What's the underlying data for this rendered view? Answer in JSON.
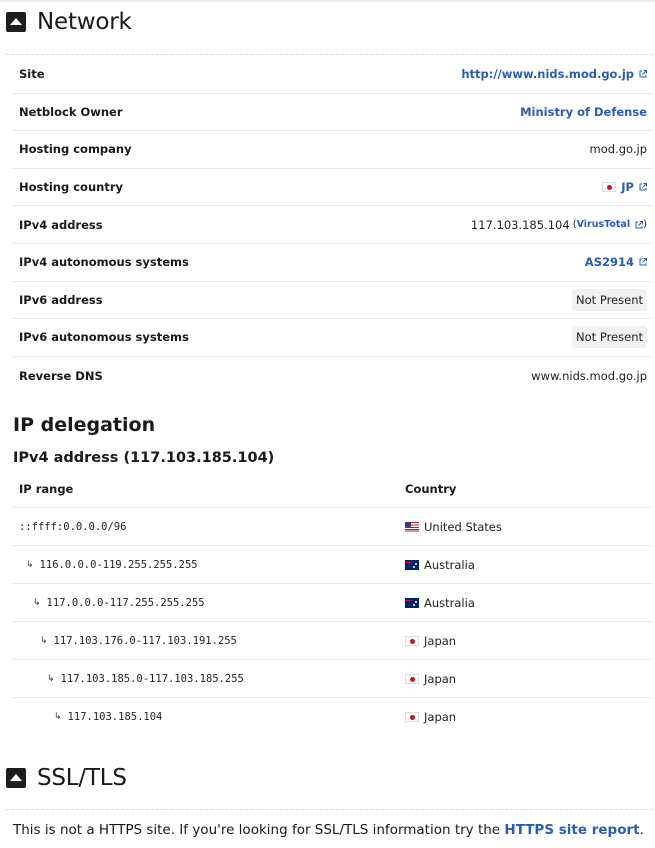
{
  "network": {
    "title": "Network",
    "rows": [
      {
        "label": "Site",
        "value": "http://www.nids.mod.go.jp",
        "kind": "link-ext"
      },
      {
        "label": "Netblock Owner",
        "value": "Ministry of Defense",
        "kind": "link"
      },
      {
        "label": "Hosting company",
        "value": "mod.go.jp",
        "kind": "text"
      },
      {
        "label": "Hosting country",
        "value": "JP",
        "kind": "flag-link",
        "flag": "jp"
      },
      {
        "label": "IPv4 address",
        "value": "117.103.185.104",
        "kind": "ip-vt",
        "extra": "VirusTotal"
      },
      {
        "label": "IPv4 autonomous systems",
        "value": "AS2914",
        "kind": "link-ext"
      },
      {
        "label": "IPv6 address",
        "value": "Not Present",
        "kind": "pill"
      },
      {
        "label": "IPv6 autonomous systems",
        "value": "Not Present",
        "kind": "pill"
      },
      {
        "label": "Reverse DNS",
        "value": "www.nids.mod.go.jp",
        "kind": "text"
      }
    ]
  },
  "ip_delegation": {
    "title": "IP delegation",
    "subtitle": "IPv4 address (117.103.185.104)",
    "headers": {
      "range": "IP range",
      "country": "Country"
    },
    "rows": [
      {
        "range": "::ffff:0.0.0.0/96",
        "country": "United States",
        "flag": "us",
        "indent": 0
      },
      {
        "range": "116.0.0.0-119.255.255.255",
        "country": "Australia",
        "flag": "au",
        "indent": 1
      },
      {
        "range": "117.0.0.0-117.255.255.255",
        "country": "Australia",
        "flag": "au",
        "indent": 2
      },
      {
        "range": "117.103.176.0-117.103.191.255",
        "country": "Japan",
        "flag": "jp",
        "indent": 3
      },
      {
        "range": "117.103.185.0-117.103.185.255",
        "country": "Japan",
        "flag": "jp",
        "indent": 4
      },
      {
        "range": "117.103.185.104",
        "country": "Japan",
        "flag": "jp",
        "indent": 5
      }
    ]
  },
  "ssl": {
    "title": "SSL/TLS",
    "message_prefix": "This is not a HTTPS site. If you're looking for SSL/TLS information try the ",
    "link_text": "HTTPS site report",
    "message_suffix": "."
  },
  "icons": {
    "toggle": "collapse-toggle-icon",
    "external": "external-link-icon",
    "arrow": "sub-range-arrow-icon"
  },
  "colors": {
    "link": "#2a5db0",
    "pill_bg": "#f1f1f1",
    "border": "#e8e8e8"
  }
}
